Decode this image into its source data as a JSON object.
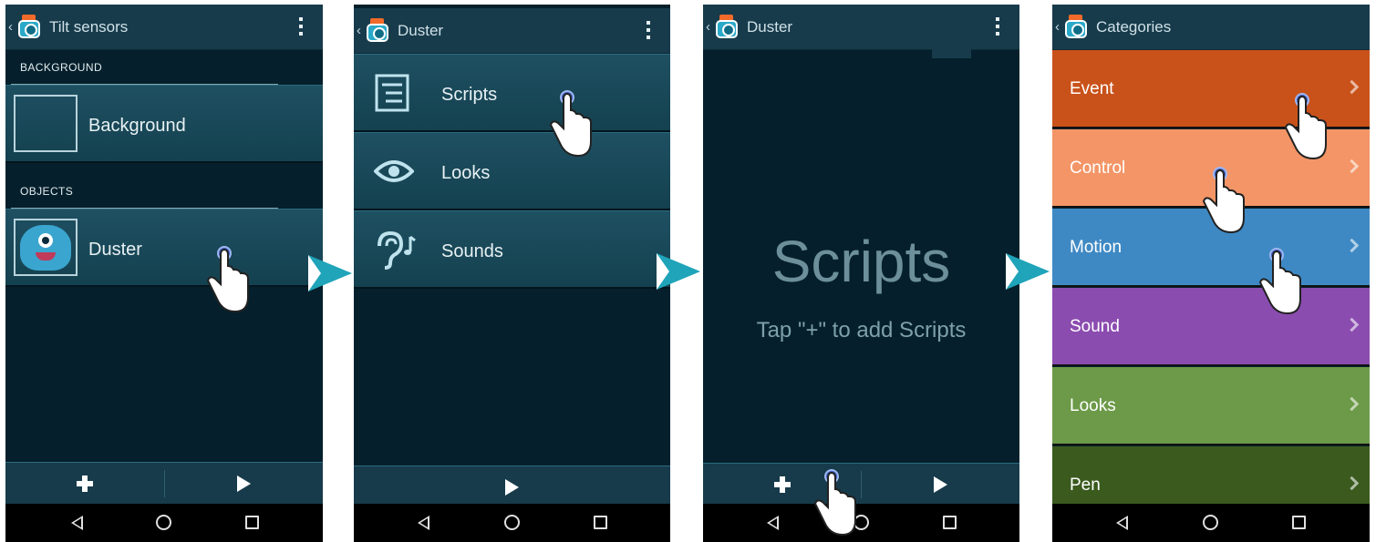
{
  "screens": {
    "s1": {
      "title": "Tilt sensors",
      "section_background": "BACKGROUND",
      "background_row": "Background",
      "section_objects": "OBJECTS",
      "object_row": "Duster"
    },
    "s2": {
      "title": "Duster",
      "menu": [
        {
          "label": "Scripts",
          "icon": "scripts-list-icon"
        },
        {
          "label": "Looks",
          "icon": "eye-icon"
        },
        {
          "label": "Sounds",
          "icon": "ear-music-icon"
        }
      ]
    },
    "s3": {
      "title": "Duster",
      "empty_title": "Scripts",
      "empty_hint": "Tap \"+\" to add Scripts"
    },
    "s4": {
      "title": "Categories",
      "categories": [
        {
          "label": "Event",
          "color": "#c9521a"
        },
        {
          "label": "Control",
          "color": "#f39566"
        },
        {
          "label": "Motion",
          "color": "#3e89c4"
        },
        {
          "label": "Sound",
          "color": "#8b4cb0"
        },
        {
          "label": "Looks",
          "color": "#6c9a48"
        },
        {
          "label": "Pen",
          "color": "#3a5a1e"
        }
      ]
    }
  },
  "colors": {
    "app_background": "#05202c",
    "app_bar": "#173b4b",
    "flow_arrow": "#1fa4b9",
    "tap_indicator": "#3a5fc7"
  },
  "icons": {
    "toolbar": [
      "add-icon",
      "play-icon"
    ],
    "navigation": [
      "nav-back-icon",
      "nav-home-icon",
      "nav-recent-icon"
    ],
    "overlay": [
      "tap-hand-icon",
      "flow-arrow-icon"
    ]
  }
}
